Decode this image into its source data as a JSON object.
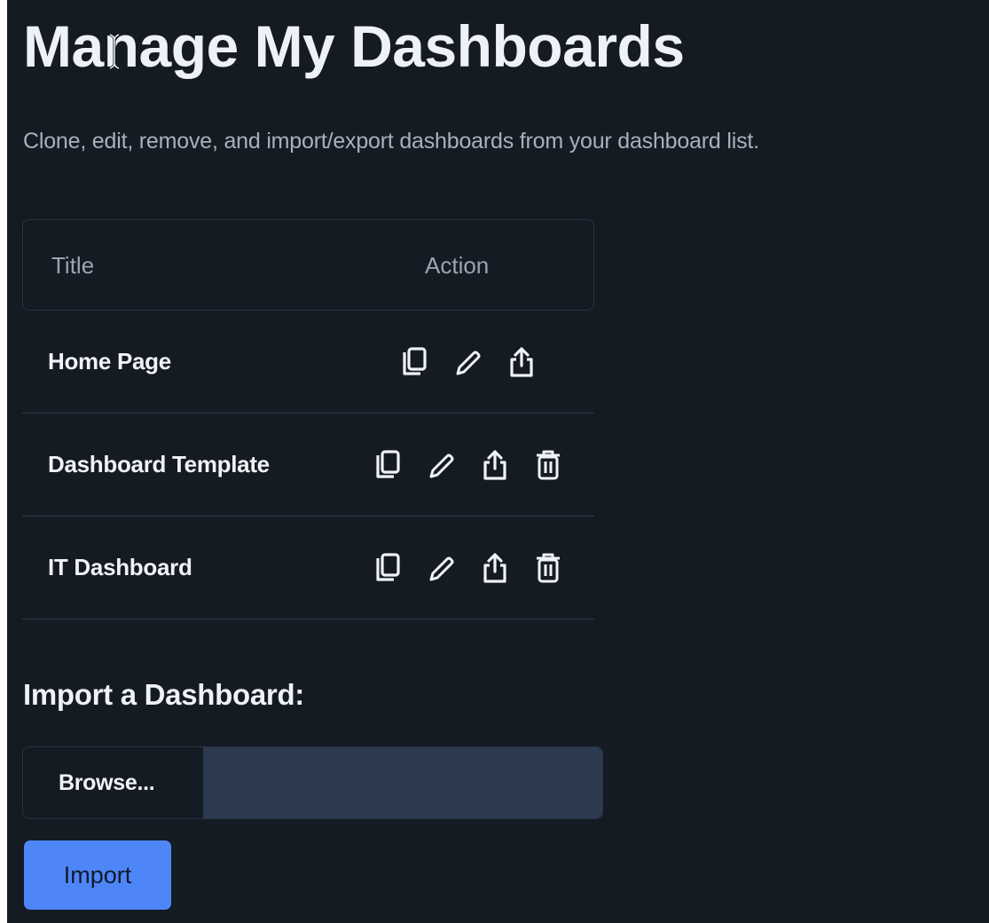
{
  "page": {
    "title": "Manage My Dashboards",
    "subtitle": "Clone, edit, remove, and import/export dashboards from your dashboard list."
  },
  "table": {
    "headers": {
      "title": "Title",
      "action": "Action"
    },
    "rows": [
      {
        "title": "Home Page",
        "actions": [
          "clone",
          "edit",
          "export"
        ]
      },
      {
        "title": "Dashboard Template",
        "actions": [
          "clone",
          "edit",
          "export",
          "delete"
        ]
      },
      {
        "title": "IT Dashboard",
        "actions": [
          "clone",
          "edit",
          "export",
          "delete"
        ]
      }
    ]
  },
  "import": {
    "section_title": "Import a Dashboard:",
    "browse_label": "Browse...",
    "file_name": "",
    "import_label": "Import"
  },
  "icons": {
    "clone": "copy-icon",
    "edit": "pencil-icon",
    "export": "share-icon",
    "delete": "trash-icon"
  },
  "colors": {
    "background": "#151b23",
    "accent": "#4f86f7",
    "file_field": "#2b3a4f"
  }
}
